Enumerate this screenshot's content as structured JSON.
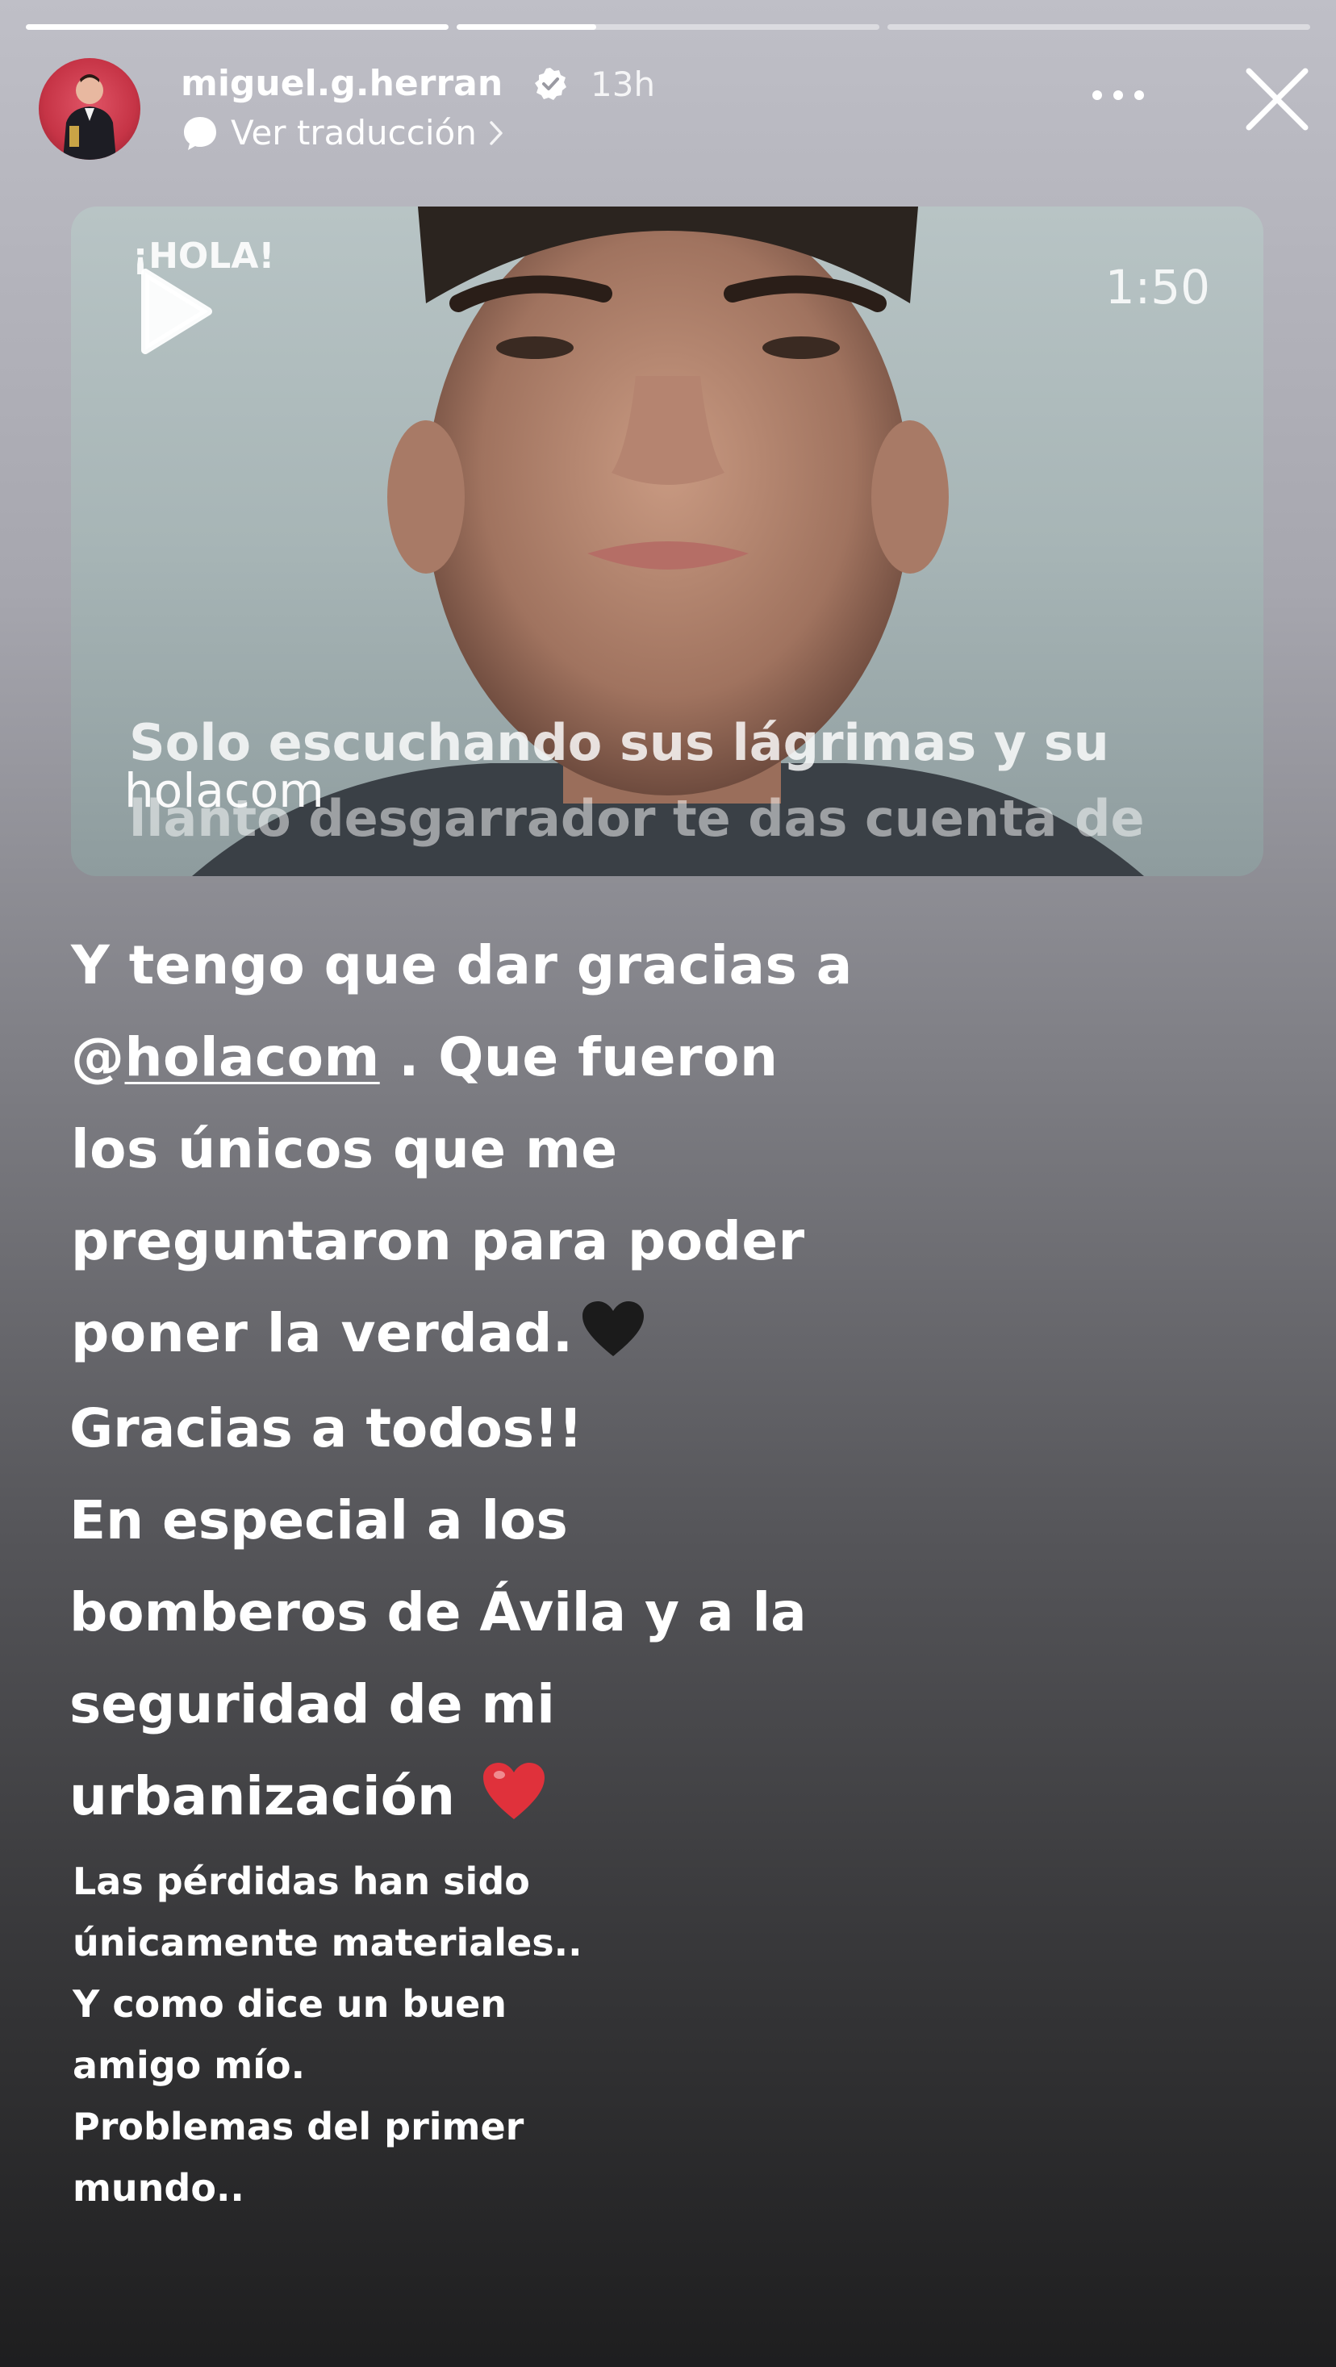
{
  "story": {
    "progress": [
      1,
      0.33,
      0
    ],
    "username": "miguel.g.herran",
    "time": "13h",
    "translate_label": "Ver traducción"
  },
  "video": {
    "duration": "1:50",
    "brand": "¡HOLA!",
    "caption_line1": "Solo escuchando sus lágrimas y su",
    "caption_line2": "llanto desgarrador te das cuenta de",
    "watermark": "holacom"
  },
  "text1": {
    "line1": "Y tengo que dar gracias a",
    "at": "@",
    "mention": "holacom",
    "line2_rest": " . Que fueron",
    "line3": "los únicos que me",
    "line4": "preguntaron para poder",
    "line5": "poner la verdad."
  },
  "text2": {
    "line1": "Gracias a todos!!",
    "line2": "En especial a los",
    "line3": "bomberos de Ávila y a la",
    "line4": "seguridad de mi",
    "line5": "urbanización "
  },
  "text3": {
    "line1": "Las pérdidas han sido",
    "line2": "únicamente materiales..",
    "line3": "Y como dice un buen",
    "line4": "amigo mío.",
    "line5": "Problemas del primer",
    "line6": "mundo.."
  },
  "colors": {
    "heart_black": "#1b1b1b",
    "heart_red": "#e0313b",
    "avatar_bg": "#c63446"
  }
}
